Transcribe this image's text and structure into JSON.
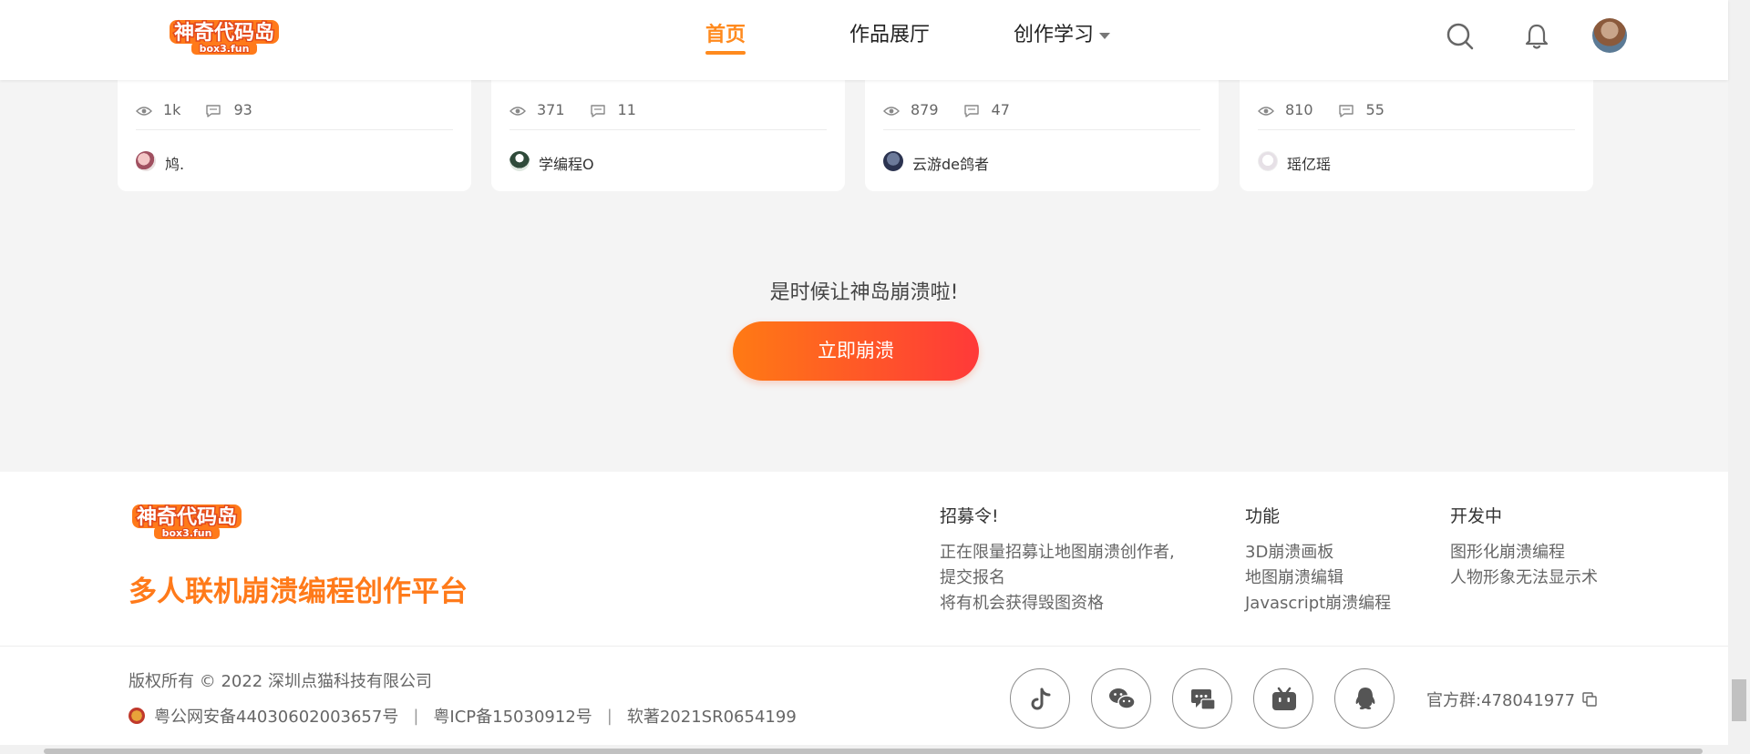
{
  "header": {
    "logo_alt": "神奇代码岛",
    "logo_sub": "box3.fun",
    "nav": [
      {
        "label": "首页",
        "active": true
      },
      {
        "label": "作品展厅",
        "active": false
      },
      {
        "label": "创作学习",
        "active": false,
        "has_dropdown": true
      }
    ],
    "icons": [
      "search-icon",
      "bell-icon",
      "user-avatar"
    ]
  },
  "cards": [
    {
      "views": "1k",
      "comments": "93",
      "author": "鸠."
    },
    {
      "views": "371",
      "comments": "11",
      "author": "学编程O"
    },
    {
      "views": "879",
      "comments": "47",
      "author": "云游de鸽者"
    },
    {
      "views": "810",
      "comments": "55",
      "author": "瑶亿瑶"
    }
  ],
  "cta": {
    "text": "是时候让神岛崩溃啦!",
    "button": "立即崩溃"
  },
  "footer": {
    "logo_alt": "神奇代码岛",
    "logo_sub": "box3.fun",
    "slogan": "多人联机崩溃编程创作平台",
    "columns": [
      {
        "title": "招募令!",
        "lines": [
          "正在限量招募让地图崩溃创作者,",
          "提交报名",
          "将有机会获得毁图资格"
        ]
      },
      {
        "title": "功能",
        "lines": [
          "3D崩溃画板",
          "地图崩溃编辑",
          "Javascript崩溃编程"
        ]
      },
      {
        "title": "开发中",
        "lines": [
          "图形化崩溃编程",
          "人物形象无法显示术"
        ]
      }
    ],
    "copyright": "版权所有 © 2022 深圳点猫科技有限公司",
    "reg": {
      "police": "粤公网安备44030602003657号",
      "separator": "|",
      "icp": "粤ICP备15030912号",
      "software": "软著2021SR0654199"
    },
    "social": [
      "tiktok-icon",
      "wechat-icon",
      "chat-icon",
      "bilibili-icon",
      "qq-icon"
    ],
    "qq_group": "官方群:478041977"
  },
  "colors": {
    "accent": "#ff8a1e",
    "slogan": "#ff7a1a",
    "cta_gradient_start": "#ff7a14",
    "cta_gradient_end": "#ff3939"
  }
}
